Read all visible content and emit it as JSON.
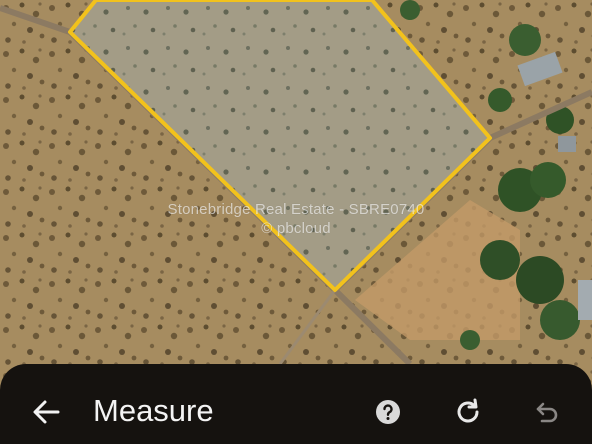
{
  "map": {
    "watermark_line1": "Stonebridge Real Estate - SBRE0740",
    "watermark_line2": "© pbcloud",
    "boundary_color": "#f2c21c"
  },
  "toolbar": {
    "title": "Measure",
    "back_icon": "arrow-back-icon",
    "help_icon": "help-icon",
    "refresh_icon": "refresh-icon",
    "undo_icon": "undo-icon"
  }
}
